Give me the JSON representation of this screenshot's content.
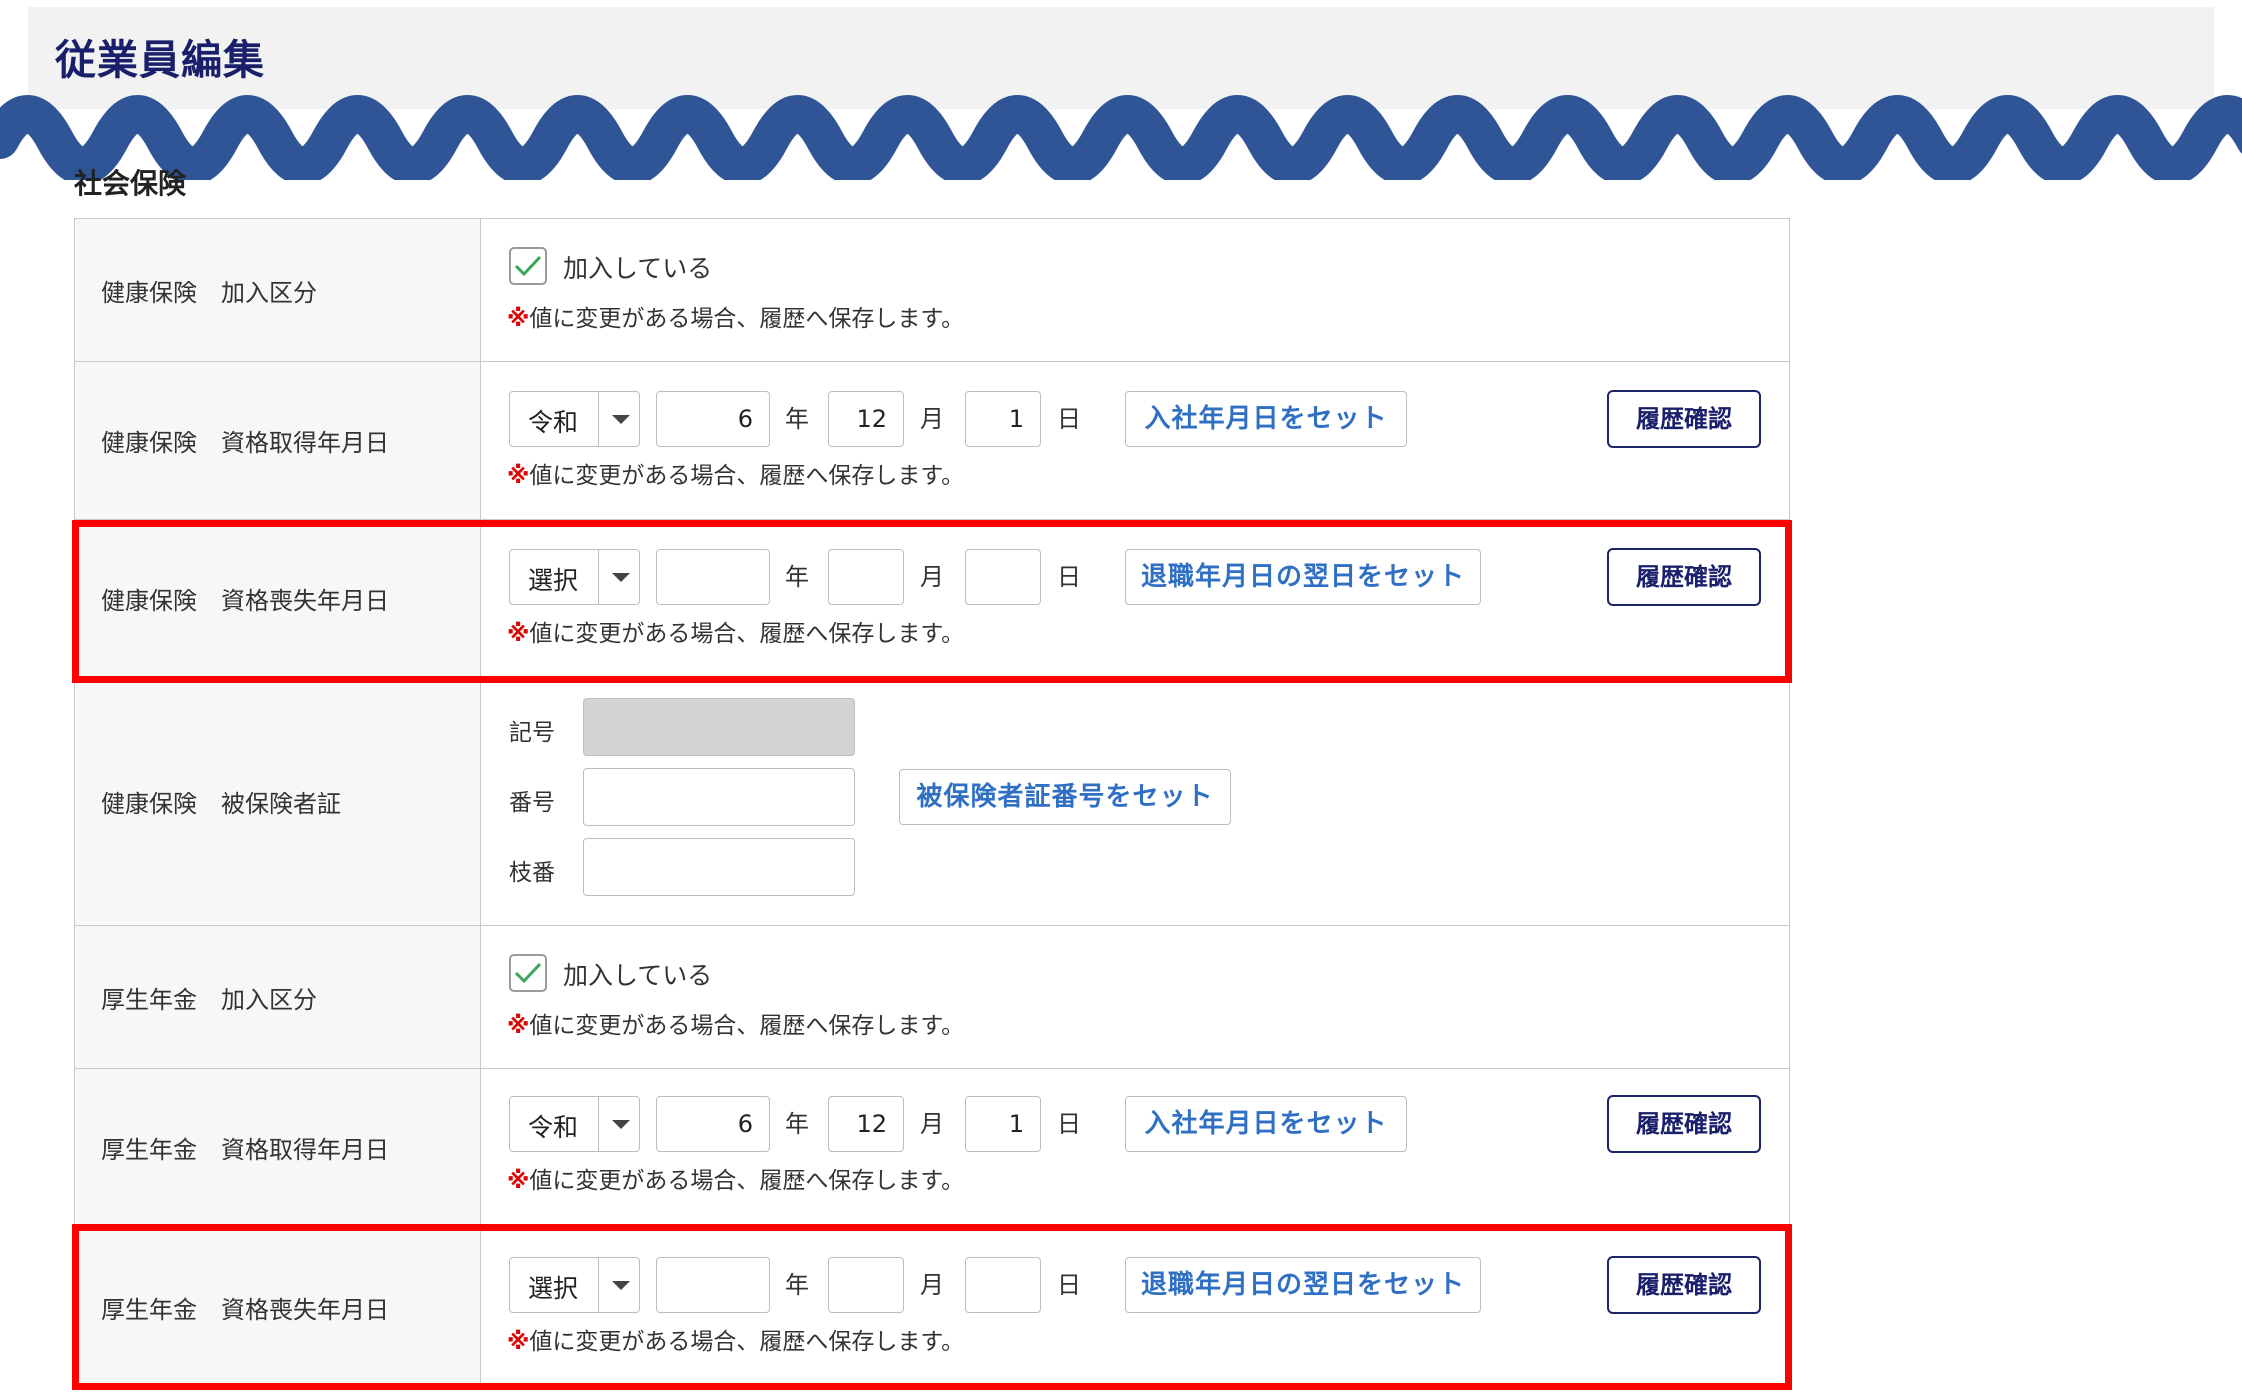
{
  "page": {
    "title": "従業員編集",
    "section": "社会保険"
  },
  "colors": {
    "wave": "#2f5596",
    "highlight": "#ff0000",
    "link": "#2f6fc4",
    "title": "#1a1f6b"
  },
  "note": {
    "mark": "※",
    "text": "値に変更がある場合、履歴へ保存します。"
  },
  "units": {
    "year": "年",
    "month": "月",
    "day": "日"
  },
  "rows": [
    {
      "label": "健康保険　加入区分",
      "checkbox_label": "加入している",
      "checked": true
    },
    {
      "label": "健康保険　資格取得年月日",
      "era": "令和",
      "year": "6",
      "month": "12",
      "day": "1",
      "set_button": "入社年月日をセット",
      "history_button": "履歴確認"
    },
    {
      "label": "健康保険　資格喪失年月日",
      "era": "選択",
      "year": "",
      "month": "",
      "day": "",
      "set_button": "退職年月日の翌日をセット",
      "history_button": "履歴確認"
    },
    {
      "label": "健康保険　被保険者証",
      "symbol_label": "記号",
      "number_label": "番号",
      "branch_label": "枝番",
      "set_button": "被保険者証番号をセット"
    },
    {
      "label": "厚生年金　加入区分",
      "checkbox_label": "加入している",
      "checked": true
    },
    {
      "label": "厚生年金　資格取得年月日",
      "era": "令和",
      "year": "6",
      "month": "12",
      "day": "1",
      "set_button": "入社年月日をセット",
      "history_button": "履歴確認"
    },
    {
      "label": "厚生年金　資格喪失年月日",
      "era": "選択",
      "year": "",
      "month": "",
      "day": "",
      "set_button": "退職年月日の翌日をセット",
      "history_button": "履歴確認"
    }
  ]
}
